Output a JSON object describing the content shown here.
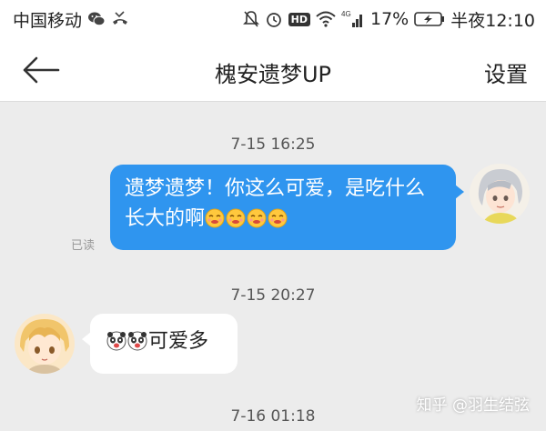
{
  "status_bar": {
    "carrier": "中国移动",
    "network": "4G",
    "battery": "17%",
    "time": "半夜12:10",
    "icons": [
      "wechat-icon",
      "missed-call-icon",
      "mute-icon",
      "alarm-icon",
      "hd-icon",
      "wifi-icon",
      "signal-icon",
      "battery-charging-icon"
    ],
    "hd_label": "HD"
  },
  "header": {
    "title": "槐安遗梦UP",
    "settings_label": "设置",
    "back_icon": "back-arrow-icon"
  },
  "messages": [
    {
      "timestamp": "7-15 16:25",
      "direction": "sent",
      "text": "遗梦遗梦！你这么可爱，是吃什么长大的啊",
      "emojis": [
        "smirk-emoji",
        "smirk-emoji",
        "smirk-emoji",
        "smirk-emoji"
      ],
      "read_status": "已读"
    },
    {
      "timestamp": "7-15 20:27",
      "direction": "received",
      "emojis": [
        "panda-emoji",
        "panda-emoji"
      ],
      "text": "可爱多"
    }
  ],
  "next_timestamp": "7-16 01:18",
  "watermark": "知乎 @羽生结弦",
  "colors": {
    "sent_bubble": "#2f95ef",
    "received_bubble": "#ffffff",
    "chat_background": "#ececec"
  }
}
